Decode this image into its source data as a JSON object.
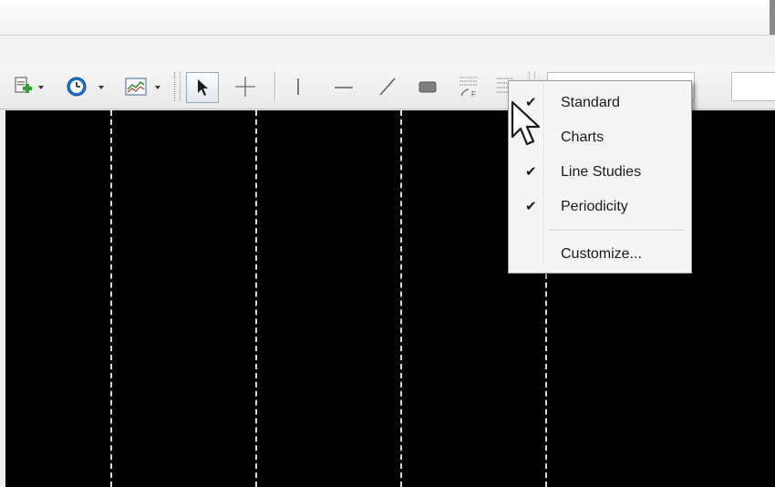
{
  "toolbar": {
    "tools": [
      {
        "name": "new-chart-icon"
      },
      {
        "name": "clock-icon"
      },
      {
        "name": "chart-type-icon"
      },
      {
        "name": "pointer-arrow-icon"
      },
      {
        "name": "crosshair-icon"
      },
      {
        "name": "vertical-line-icon"
      },
      {
        "name": "horizontal-line-icon"
      },
      {
        "name": "trend-line-icon"
      },
      {
        "name": "rectangle-icon"
      },
      {
        "name": "fibonacci-icon"
      },
      {
        "name": "toolbar-options-icon"
      }
    ]
  },
  "context_menu": {
    "items": [
      {
        "label": "Standard",
        "checked": true
      },
      {
        "label": "Charts",
        "checked": false
      },
      {
        "label": "Line Studies",
        "checked": true
      },
      {
        "label": "Periodicity",
        "checked": true
      }
    ],
    "customize_label": "Customize...",
    "check_glyph": "✔"
  },
  "colors": {
    "chart_background": "#000000",
    "gridline": "#d8d8d8",
    "menu_background": "#f5f5f5"
  }
}
